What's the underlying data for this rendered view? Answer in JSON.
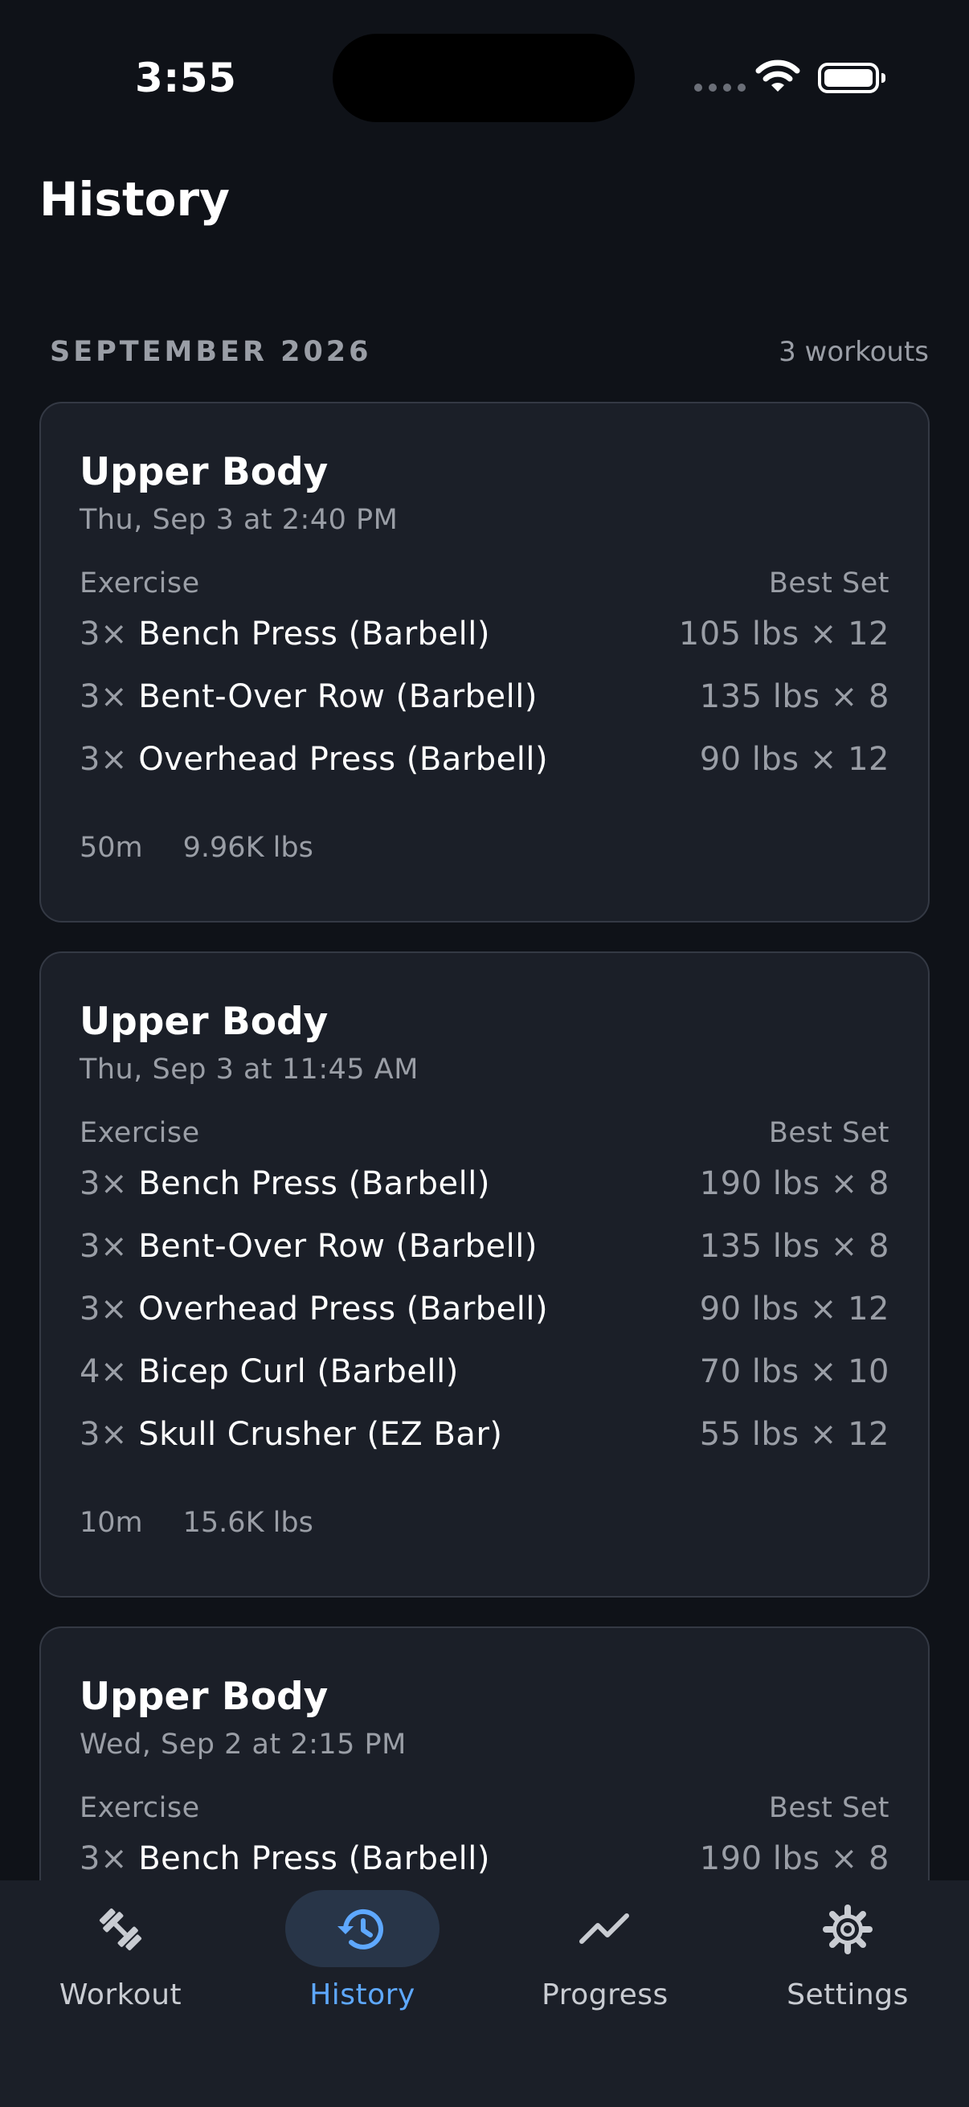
{
  "status_bar": {
    "time": "3:55"
  },
  "page": {
    "title": "History"
  },
  "section": {
    "month": "SEPTEMBER 2026",
    "count": "3 workouts"
  },
  "column_headers": {
    "exercise": "Exercise",
    "best_set": "Best Set"
  },
  "workouts": [
    {
      "title": "Upper Body",
      "date": "Thu, Sep 3 at 2:40 PM",
      "exercises": [
        {
          "sets": "3×",
          "name": "Bench Press (Barbell)",
          "best": "105 lbs × 12"
        },
        {
          "sets": "3×",
          "name": "Bent-Over Row (Barbell)",
          "best": "135 lbs × 8"
        },
        {
          "sets": "3×",
          "name": "Overhead Press (Barbell)",
          "best": "90 lbs × 12"
        }
      ],
      "duration": "50m",
      "volume": "9.96K lbs"
    },
    {
      "title": "Upper Body",
      "date": "Thu, Sep 3 at 11:45 AM",
      "exercises": [
        {
          "sets": "3×",
          "name": "Bench Press (Barbell)",
          "best": "190 lbs × 8"
        },
        {
          "sets": "3×",
          "name": "Bent-Over Row (Barbell)",
          "best": "135 lbs × 8"
        },
        {
          "sets": "3×",
          "name": "Overhead Press (Barbell)",
          "best": "90 lbs × 12"
        },
        {
          "sets": "4×",
          "name": "Bicep Curl (Barbell)",
          "best": "70 lbs × 10"
        },
        {
          "sets": "3×",
          "name": "Skull Crusher (EZ Bar)",
          "best": "55 lbs × 12"
        }
      ],
      "duration": "10m",
      "volume": "15.6K lbs"
    },
    {
      "title": "Upper Body",
      "date": "Wed, Sep 2 at 2:15 PM",
      "exercises": [
        {
          "sets": "3×",
          "name": "Bench Press (Barbell)",
          "best": "190 lbs × 8"
        }
      ]
    }
  ],
  "tab_bar": {
    "active": "History",
    "tabs": [
      {
        "label": "Workout",
        "icon": "dumbbell-icon"
      },
      {
        "label": "History",
        "icon": "history-icon"
      },
      {
        "label": "Progress",
        "icon": "trend-line-icon"
      },
      {
        "label": "Settings",
        "icon": "gear-icon"
      }
    ]
  },
  "colors": {
    "background": "#0f1218",
    "card": "#1b1f28",
    "card_border": "#343944",
    "secondary_text": "#9a9ea6",
    "accent": "#5ea8ff",
    "active_tab_pill": "#283548"
  }
}
